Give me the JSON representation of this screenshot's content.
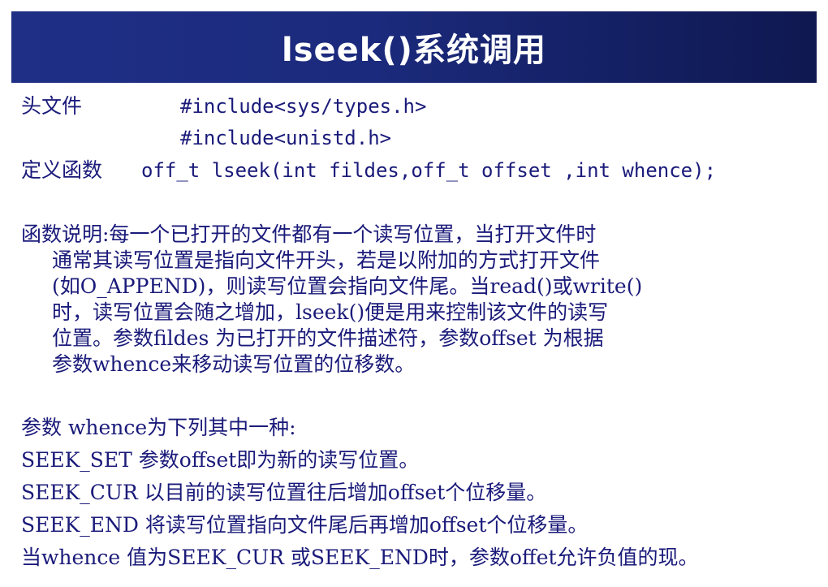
{
  "title": "lseek()系统调用",
  "header": {
    "label": "头文件",
    "include1": "#include<sys/types.h>",
    "include2": "#include<unistd.h>"
  },
  "definition": {
    "label": "定义函数",
    "signature": "off_t lseek(int fildes,off_t offset ,int whence);"
  },
  "description": {
    "lines": [
      "函数说明:每一个已打开的文件都有一个读写位置，当打开文件时",
      "通常其读写位置是指向文件开头，若是以附加的方式打开文件",
      "(如O_APPEND)，则读写位置会指向文件尾。当read()或write()",
      "时，读写位置会随之增加，lseek()便是用来控制该文件的读写",
      "位置。参数fildes 为已打开的文件描述符，参数offset 为根据",
      "参数whence来移动读写位置的位移数。"
    ]
  },
  "whence": {
    "intro": "参数 whence为下列其中一种:",
    "items": [
      "SEEK_SET 参数offset即为新的读写位置。",
      "SEEK_CUR 以目前的读写位置往后增加offset个位移量。",
      "SEEK_END 将读写位置指向文件尾后再增加offset个位移量。",
      "当whence 值为SEEK_CUR 或SEEK_END时，参数offet允许负值的现。"
    ]
  }
}
